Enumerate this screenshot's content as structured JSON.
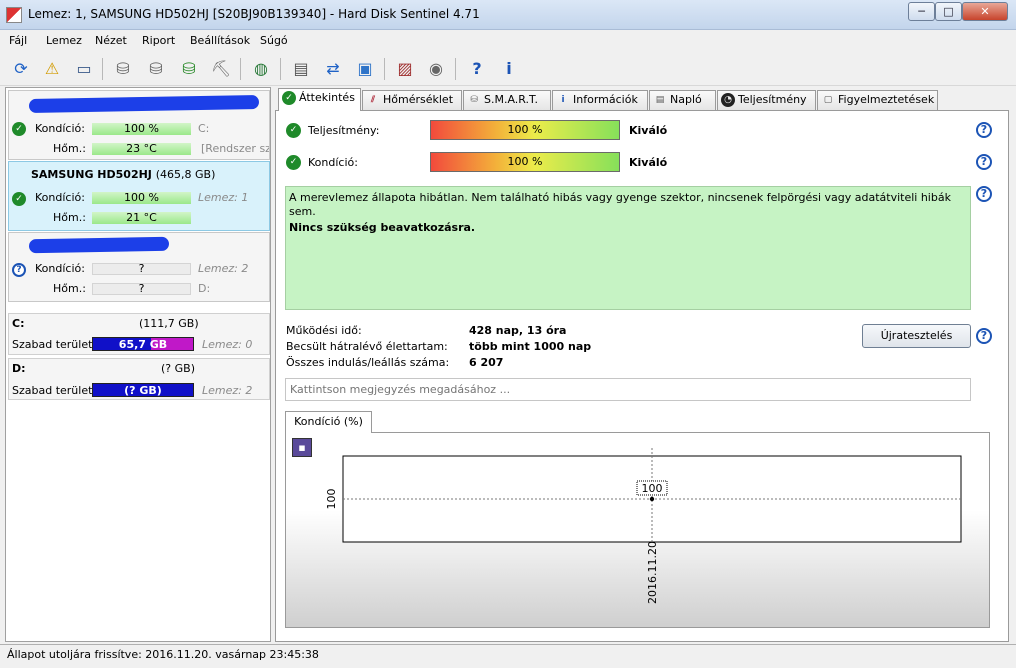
{
  "window": {
    "title": "Lemez: 1, SAMSUNG HD502HJ [S20BJ90B139340]  -  Hard Disk Sentinel 4.71",
    "min": "─",
    "max": "□",
    "close": "✕"
  },
  "menu": [
    "Fájl",
    "Lemez",
    "Nézet",
    "Riport",
    "Beállítások",
    "Súgó"
  ],
  "toolbar_icons": [
    "refresh-icon",
    "alert-icon",
    "disk-icon",
    "disk-test-icon",
    "disk-test2-icon",
    "disk-ok-icon",
    "disk-tools-icon",
    "globe-icon",
    "report-icon",
    "transfer-icon",
    "network-icon",
    "monitor-icon",
    "sound-icon",
    "help-icon",
    "info-icon"
  ],
  "disks": [
    {
      "name": "",
      "labels": {
        "condition": "Kondíció:",
        "temp": "Hőm.:"
      },
      "condition": "100 %",
      "temp": "23 °C",
      "drive": "C:",
      "note": "[Rendszer szá"
    },
    {
      "name": "SAMSUNG HD502HJ",
      "size": "(465,8 GB)",
      "labels": {
        "condition": "Kondíció:",
        "temp": "Hőm.:"
      },
      "condition": "100 %",
      "temp": "21 °C",
      "disk_ref": "Lemez: 1"
    },
    {
      "name": "",
      "labels": {
        "condition": "Kondíció:",
        "temp": "Hőm.:"
      },
      "condition": "?",
      "temp": "?",
      "disk_ref": "Lemez: 2",
      "drive": "D:"
    }
  ],
  "partitions": [
    {
      "drive": "C:",
      "size": "(111,7 GB)",
      "free_label": "Szabad terület",
      "free": "65,7 GB",
      "disk_ref": "Lemez: 0"
    },
    {
      "drive": "D:",
      "size": "(? GB)",
      "free_label": "Szabad terület",
      "free": "(? GB)",
      "disk_ref": "Lemez: 2"
    }
  ],
  "tabs": [
    "Áttekintés",
    "Hőmérséklet",
    "S.M.A.R.T.",
    "Információk",
    "Napló",
    "Teljesítmény",
    "Figyelmeztetések"
  ],
  "overview": {
    "performance_label": "Teljesítmény:",
    "performance_value": "100 %",
    "performance_rating": "Kiváló",
    "condition_label": "Kondíció:",
    "condition_value": "100 %",
    "condition_rating": "Kiváló",
    "status_text": "A merevlemez állapota hibátlan. Nem található hibás vagy gyenge szektor, nincsenek felpörgési vagy adatátviteli hibák sem.",
    "action_text": "Nincs szükség beavatkozásra.",
    "stats": [
      {
        "label": "Működési idő:",
        "value": "428 nap, 13 óra"
      },
      {
        "label": "Becsült hátralévő élettartam:",
        "value": "több mint 1000 nap"
      },
      {
        "label": "Összes indulás/leállás száma:",
        "value": "6 207"
      }
    ],
    "retest_button": "Újratesztelés",
    "note_placeholder": "Kattintson megjegyzés megadásához ..."
  },
  "chart_tab": "Kondíció  (%)",
  "chart_data": {
    "type": "line",
    "x": [
      "2016.11.20"
    ],
    "values": [
      100
    ],
    "y_tick": "100",
    "data_label": "100"
  },
  "statusbar": {
    "text": "Állapot utoljára frissítve: 2016.11.20. vasárnap 23:45:38"
  }
}
